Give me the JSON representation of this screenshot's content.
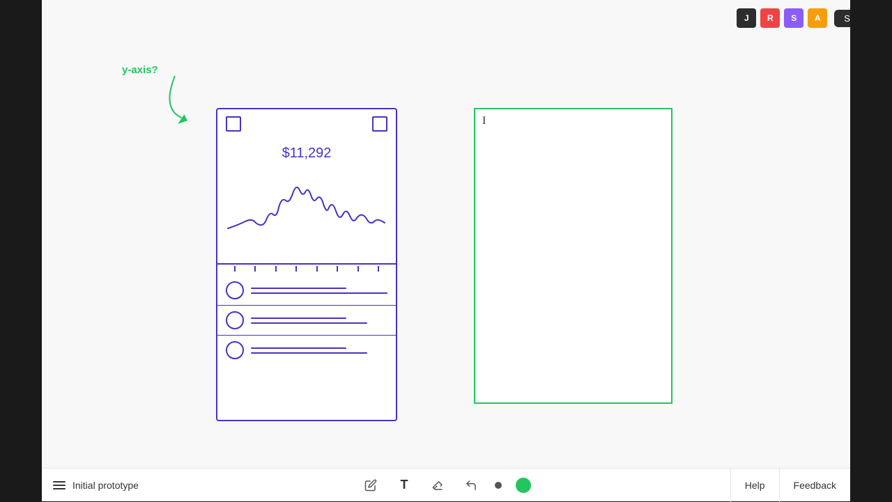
{
  "topbar": {
    "avatars": [
      {
        "id": "J",
        "color": "#1a1a1a",
        "bg": "#1a1a1a",
        "letter": "J"
      },
      {
        "id": "R",
        "color": "#ef4444",
        "bg": "#ef4444",
        "letter": "R"
      },
      {
        "id": "S",
        "color": "#8b5cf6",
        "bg": "#8b5cf6",
        "letter": "S"
      },
      {
        "id": "A",
        "color": "#f59e0b",
        "bg": "#f59e0b",
        "letter": "A"
      }
    ],
    "share_label": "Share"
  },
  "bottombar": {
    "project_name": "Initial prototype",
    "help_label": "Help",
    "feedback_label": "Feedback"
  },
  "canvas": {
    "annotation_text": "y-axis?",
    "phone": {
      "amount": "$11,292"
    },
    "textbox": {
      "cursor": "I"
    }
  }
}
